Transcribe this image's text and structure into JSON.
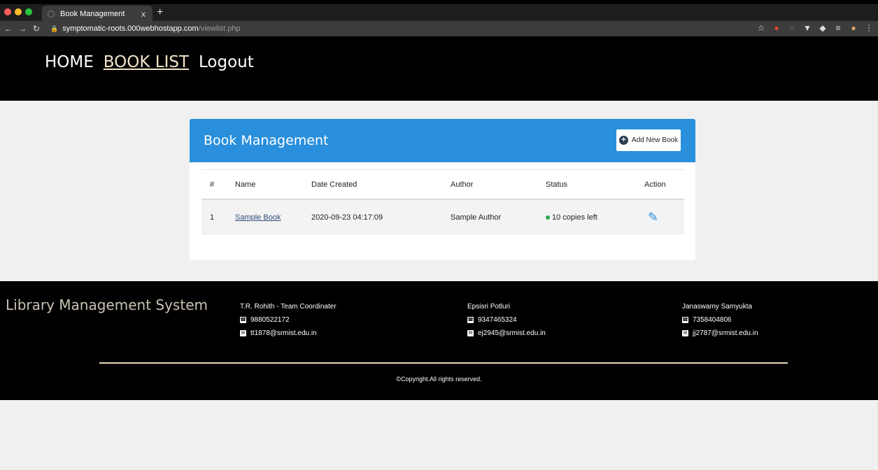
{
  "browser": {
    "tab_title": "Book Management",
    "tab_close": "x",
    "new_tab": "+",
    "url_host": "symptomatic-roots.000webhostapp.com",
    "url_path": "/viewlist.php"
  },
  "nav": {
    "home": "HOME",
    "book_list": "BOOK LIST",
    "logout": "Logout"
  },
  "card": {
    "title": "Book Management",
    "add_button": "Add New Book"
  },
  "table": {
    "headers": [
      "#",
      "Name",
      "Date Created",
      "Author",
      "Status",
      "Action"
    ],
    "rows": [
      {
        "num": "1",
        "name": "Sample Book",
        "date": "2020-09-23 04:17:09",
        "author": "Sample Author",
        "status": "10 copies left"
      }
    ]
  },
  "footer": {
    "brand": "Library Management System",
    "members": [
      {
        "name": "T.R. Rohith - Team Coordinater",
        "phone": "9880522172",
        "email": "tt1878@srmist.edu.in"
      },
      {
        "name": "Epsisri Potluri",
        "phone": "9347465324",
        "email": "ej2945@srmist.edu.in"
      },
      {
        "name": "Janaswamy Samyukta",
        "phone": "7358404806",
        "email": "jj2787@srmist.edu.in"
      }
    ],
    "copyright": "©Copyright.All rights reserved."
  },
  "colors": {
    "header_bg": "#000000",
    "card_header": "#2a8fdc",
    "status_dot": "#2ca84a",
    "active_nav": "#f3e4c8"
  }
}
